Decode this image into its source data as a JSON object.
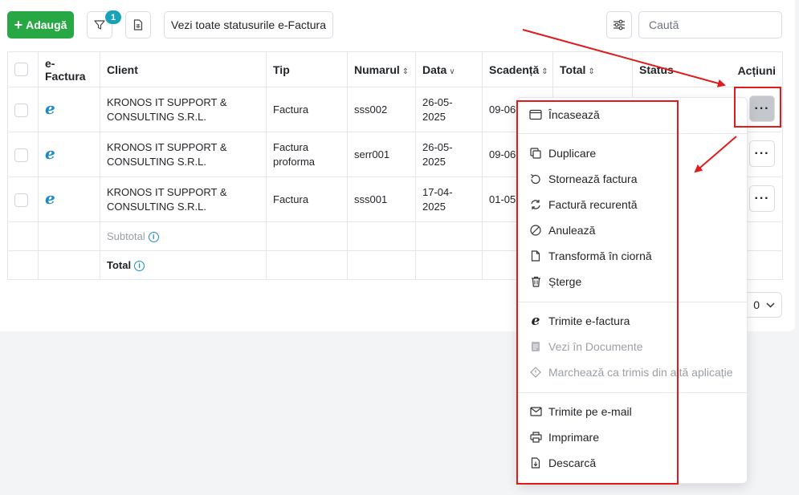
{
  "toolbar": {
    "add_label": "Adaugă",
    "filter_badge": "1",
    "status_button": "Vezi toate statusurile e-Factura",
    "search_placeholder": "Caută"
  },
  "table": {
    "headers": [
      "e-Factura",
      "Client",
      "Tip",
      "Numarul",
      "Data",
      "Scadență",
      "Total",
      "Status",
      "Acțiuni"
    ],
    "rows": [
      {
        "client_line1": "KRONOS IT SUPPORT &",
        "client_line2": "CONSULTING S.R.L.",
        "tip_line1": "Factura",
        "tip_line2": "",
        "numar": "sss002",
        "data": "26-05-2025",
        "scadenta": "09-06"
      },
      {
        "client_line1": "KRONOS IT SUPPORT &",
        "client_line2": "CONSULTING S.R.L.",
        "tip_line1": "Factura",
        "tip_line2": "proforma",
        "numar": "serr001",
        "data": "26-05-2025",
        "scadenta": "09-06"
      },
      {
        "client_line1": "KRONOS IT SUPPORT &",
        "client_line2": "CONSULTING S.R.L.",
        "tip_line1": "Factura",
        "tip_line2": "",
        "numar": "sss001",
        "data": "17-04-2025",
        "scadenta": "01-05"
      }
    ],
    "subtotal_label": "Subtotal",
    "total_label": "Total",
    "efactura_glyph": "e"
  },
  "pager": {
    "value": "0"
  },
  "menu": {
    "items": [
      {
        "label": "Încasează",
        "icon": "card-icon",
        "disabled": false
      },
      {
        "label": "Duplicare",
        "icon": "copy-icon",
        "disabled": false
      },
      {
        "label": "Stornează factura",
        "icon": "undo-icon",
        "disabled": false
      },
      {
        "label": "Factură recurentă",
        "icon": "repeat-icon",
        "disabled": false
      },
      {
        "label": "Anulează",
        "icon": "cancel-icon",
        "disabled": false
      },
      {
        "label": "Transformă în ciornă",
        "icon": "document-icon",
        "disabled": false
      },
      {
        "label": "Șterge",
        "icon": "trash-icon",
        "disabled": false
      },
      {
        "label": "Trimite e-factura",
        "icon": "efactura-icon",
        "disabled": false
      },
      {
        "label": "Vezi în Documente",
        "icon": "folder-doc-icon",
        "disabled": true
      },
      {
        "label": "Marchează ca trimis din altă aplicație",
        "icon": "tag-icon",
        "disabled": true
      },
      {
        "label": "Trimite pe e-mail",
        "icon": "mail-icon",
        "disabled": false
      },
      {
        "label": "Imprimare",
        "icon": "printer-icon",
        "disabled": false
      },
      {
        "label": "Descarcă",
        "icon": "download-icon",
        "disabled": false
      }
    ]
  },
  "colors": {
    "add_button": "#28a745",
    "badge": "#17a2b8",
    "efactura": "#1c8bc7",
    "annotation_red": "#e01b1b"
  }
}
